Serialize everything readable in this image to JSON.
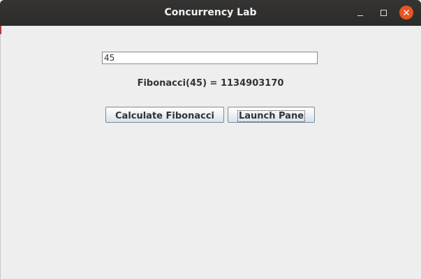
{
  "window": {
    "title": "Concurrency Lab",
    "close_color": "#e95420"
  },
  "form": {
    "input_value": "45",
    "result_text": "Fibonacci(45) = 1134903170",
    "calculate_label": "Calculate Fibonacci",
    "launch_label": "Launch Pane"
  },
  "icons": {
    "minimize": "minimize-icon",
    "maximize": "maximize-icon",
    "close": "close-icon"
  }
}
